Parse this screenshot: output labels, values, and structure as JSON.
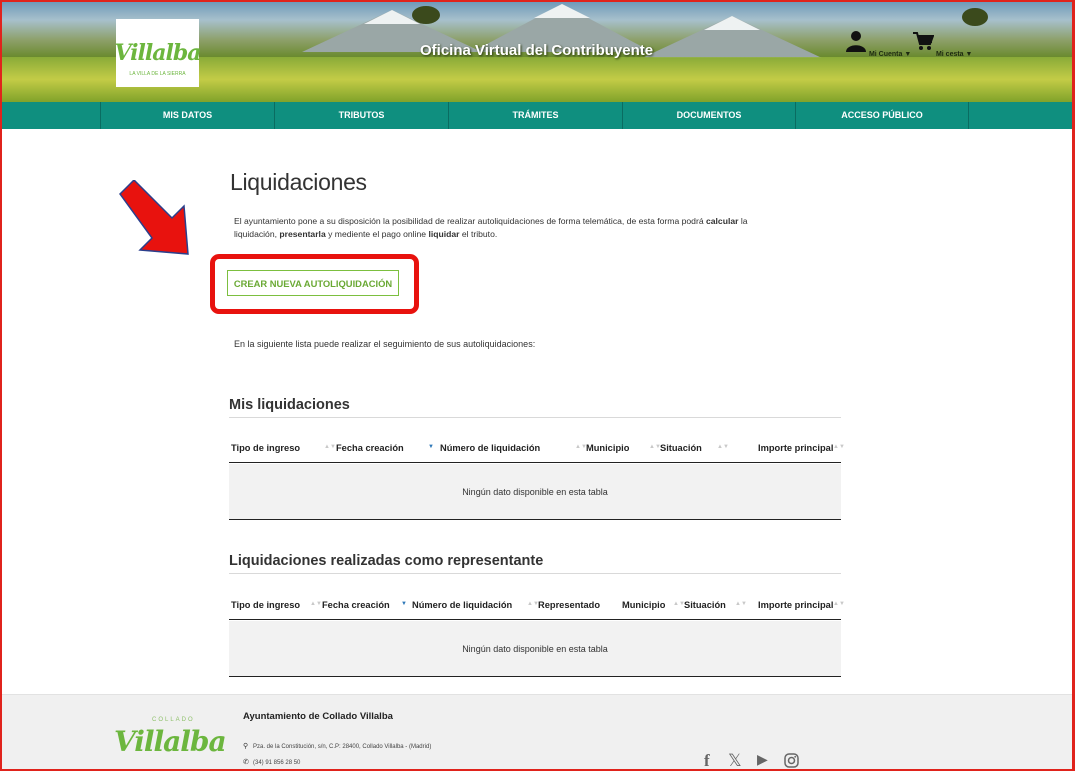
{
  "header": {
    "logo_text": "Villalba",
    "logo_sub": "LA VILLA DE LA SIERRA",
    "title": "Oficina Virtual del Contribuyente",
    "account_label": "Mi Cuenta ▼",
    "cart_label": "Mi cesta ▼"
  },
  "nav": {
    "items": [
      {
        "label": "MIS DATOS"
      },
      {
        "label": "TRIBUTOS"
      },
      {
        "label": "TRÁMITES"
      },
      {
        "label": "DOCUMENTOS"
      },
      {
        "label": "ACCESO PÚBLICO"
      }
    ]
  },
  "main": {
    "title": "Liquidaciones",
    "intro_1": "El ayuntamiento pone a su disposición la posibilidad de realizar autoliquidaciones de forma telemática, de esta forma podrá ",
    "intro_b1": "calcular",
    "intro_2": " la liquidación, ",
    "intro_b2": "presentarla",
    "intro_3": " y mediente el pago online ",
    "intro_b3": "liquidar",
    "intro_4": " el tributo.",
    "create_button": "CREAR NUEVA AUTOLIQUIDACIÓN",
    "list_note": "En la siguiente lista puede realizar el seguimiento de sus autoliquidaciones:"
  },
  "mis_liquidaciones": {
    "title": "Mis liquidaciones",
    "columns": [
      "Tipo de ingreso",
      "Fecha creación",
      "Número de liquidación",
      "Municipio",
      "Situación",
      "Importe principal"
    ],
    "empty_text": "Ningún dato disponible en esta tabla"
  },
  "representante": {
    "title": "Liquidaciones realizadas como representante",
    "columns": [
      "Tipo de ingreso",
      "Fecha creación",
      "Número de liquidación",
      "Representado",
      "Municipio",
      "Situación",
      "Importe principal"
    ],
    "empty_text": "Ningún dato disponible en esta tabla"
  },
  "footer": {
    "logo_top": "COLLADO",
    "logo_text": "Villalba",
    "org_name": "Ayuntamiento de Collado Villalba",
    "address": "Pza. de la Constitución, s/n, C.P: 28400, Collado Villalba - (Madrid)",
    "phone": "(34) 91 856 28 50",
    "social": [
      "facebook-icon",
      "x-icon",
      "youtube-icon",
      "instagram-icon"
    ]
  }
}
